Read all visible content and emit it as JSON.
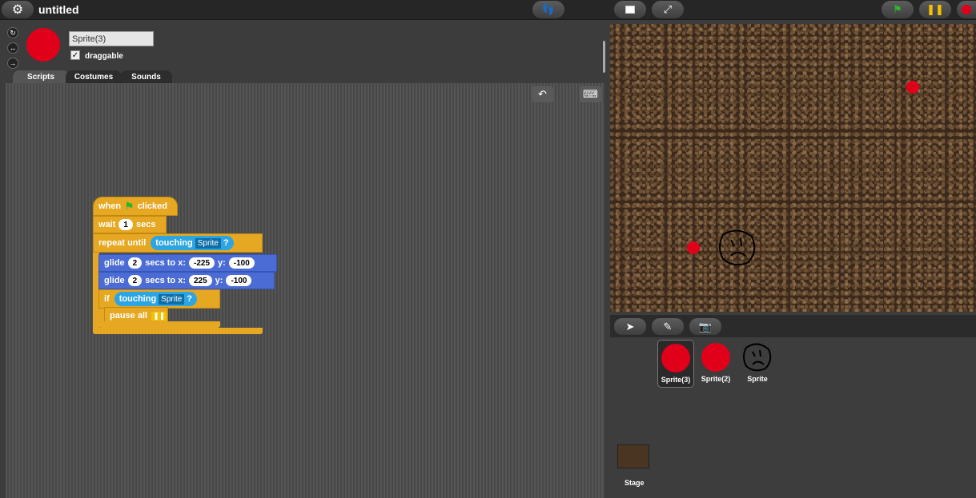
{
  "header": {
    "title": "untitled"
  },
  "sprite": {
    "name": "Sprite(3)",
    "draggable_label": "draggable",
    "draggable_checked": "✓"
  },
  "tabs": [
    {
      "label": "Scripts"
    },
    {
      "label": "Costumes"
    },
    {
      "label": "Sounds"
    }
  ],
  "script": {
    "hat": {
      "pre": "when",
      "post": "clicked"
    },
    "wait": {
      "pre": "wait",
      "value": "1",
      "post": "secs"
    },
    "repeat": {
      "label": "repeat until",
      "cond_label": "touching",
      "cond_target": "Sprite",
      "cond_q": "?"
    },
    "glide1": {
      "pre": "glide",
      "secs": "2",
      "mid": "secs to x:",
      "x": "-225",
      "ylab": "y:",
      "y": "-100"
    },
    "glide2": {
      "pre": "glide",
      "secs": "2",
      "mid": "secs to x:",
      "x": "225",
      "ylab": "y:",
      "y": "-100"
    },
    "if_block": {
      "label": "if",
      "cond_label": "touching",
      "cond_target": "Sprite",
      "cond_q": "?"
    },
    "pause": {
      "label": "pause all"
    }
  },
  "corral": {
    "sprites": [
      {
        "label": "Sprite(3)"
      },
      {
        "label": "Sprite(2)"
      },
      {
        "label": "Sprite"
      }
    ],
    "stage_label": "Stage"
  },
  "colors": {
    "accent_red": "#e0001a",
    "control": "#e6a822",
    "motion": "#4a6cd4",
    "sensing": "#2ca5e2"
  }
}
